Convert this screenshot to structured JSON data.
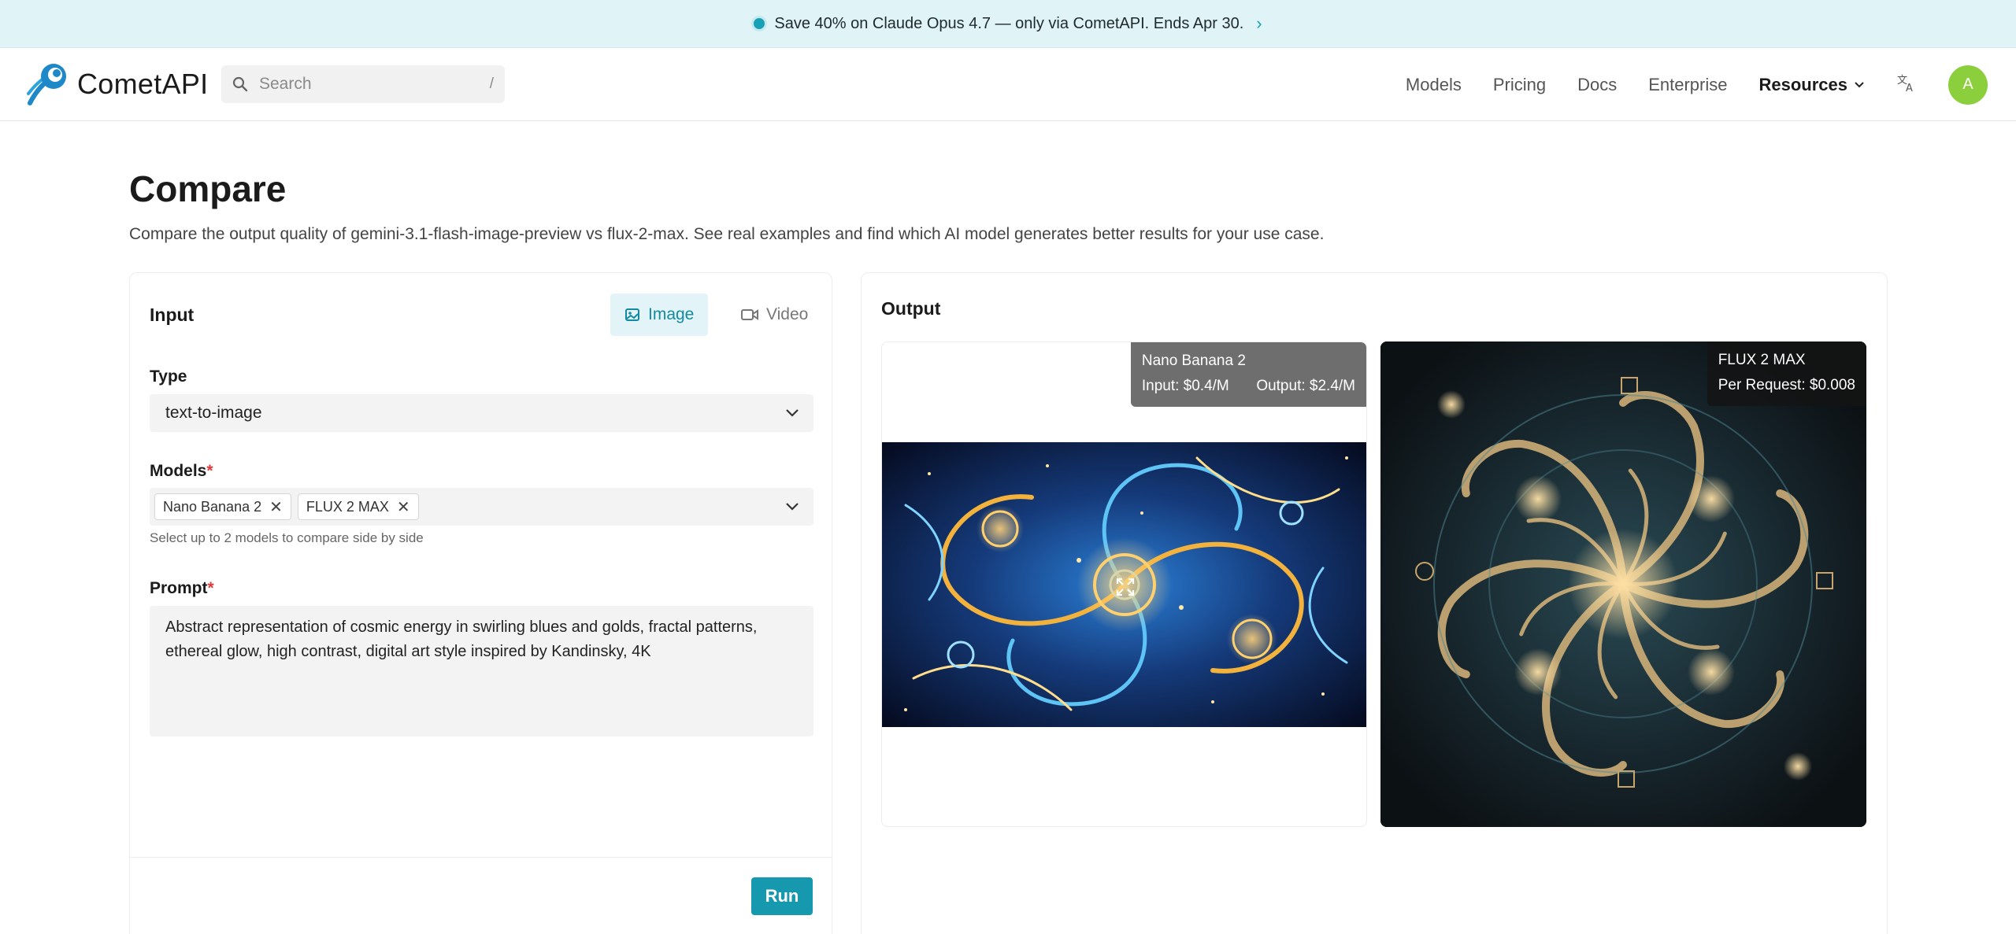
{
  "banner": {
    "text": "Save 40% on Claude Opus 4.7 — only via CometAPI. Ends Apr 30.",
    "chevron": "›"
  },
  "header": {
    "brand": "CometAPI",
    "search_placeholder": "Search",
    "search_shortcut": "/",
    "nav": [
      "Models",
      "Pricing",
      "Docs",
      "Enterprise",
      "Resources"
    ],
    "avatar_initial": "A"
  },
  "page": {
    "title": "Compare",
    "subtitle": "Compare the output quality of gemini-3.1-flash-image-preview vs flux-2-max. See real examples and find which AI model generates better results for your use case."
  },
  "input": {
    "title": "Input",
    "mode_image": "Image",
    "mode_video": "Video",
    "type_label": "Type",
    "type_value": "text-to-image",
    "models_label": "Models",
    "required_mark": "*",
    "models": [
      "Nano Banana 2",
      "FLUX 2 MAX"
    ],
    "models_hint": "Select up to 2 models to compare side by side",
    "prompt_label": "Prompt",
    "prompt_value": "Abstract representation of cosmic energy in swirling blues and golds, fractal patterns, ethereal glow, high contrast, digital art style inspired by Kandinsky, 4K",
    "run_label": "Run"
  },
  "output": {
    "title": "Output",
    "results": [
      {
        "model": "Nano Banana 2",
        "input_price": "Input: $0.4/M",
        "output_price": "Output: $2.4/M"
      },
      {
        "model": "FLUX 2 MAX",
        "per_request": "Per Request: $0.008"
      }
    ]
  },
  "colors": {
    "accent": "#1698ae",
    "banner_bg": "#e0f3f7",
    "avatar": "#8ccf3c",
    "required": "#e03a3a"
  },
  "icons": [
    "banner-dot-icon",
    "chevron-right-icon",
    "comet-logo-icon",
    "search-icon",
    "chevron-down-icon",
    "translate-icon",
    "image-icon",
    "video-icon",
    "close-icon",
    "expand-icon"
  ]
}
